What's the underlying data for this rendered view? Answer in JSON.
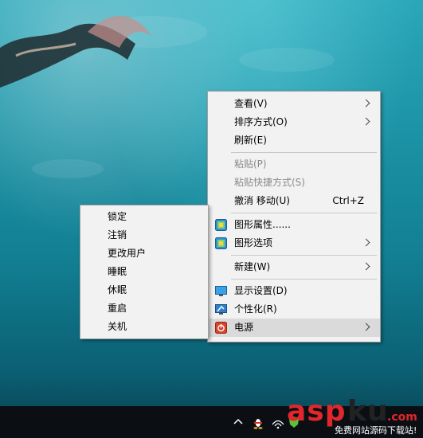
{
  "desktop_menu": {
    "items": [
      {
        "label": "查看(V)"
      },
      {
        "label": "排序方式(O)"
      },
      {
        "label": "刷新(E)"
      },
      {
        "label": "粘贴(P)"
      },
      {
        "label": "粘贴快捷方式(S)"
      },
      {
        "label": "撤消 移动(U)",
        "shortcut": "Ctrl+Z"
      },
      {
        "label": "图形属性......"
      },
      {
        "label": "图形选项"
      },
      {
        "label": "新建(W)"
      },
      {
        "label": "显示设置(D)"
      },
      {
        "label": "个性化(R)"
      },
      {
        "label": "电源"
      }
    ]
  },
  "power_submenu": {
    "items": [
      {
        "label": "锁定"
      },
      {
        "label": "注销"
      },
      {
        "label": "更改用户"
      },
      {
        "label": "睡眠"
      },
      {
        "label": "休眠"
      },
      {
        "label": "重启"
      },
      {
        "label": "关机"
      }
    ]
  },
  "watermark": {
    "brand_asp": "asp",
    "brand_ku": "ku",
    "brand_com": ".com",
    "tagline": "免费网站源码下载站!"
  },
  "colors": {
    "menu_bg": "#f2f2f2",
    "highlight": "#dadada",
    "disabled_text": "#8a8a8a",
    "taskbar": "#0b0f14",
    "brand_red": "#e3262b",
    "brand_dark": "#222222"
  },
  "icons": {
    "graphics_properties": "intel-graphics-icon",
    "graphics_options": "intel-graphics-icon",
    "display_settings": "monitor-icon",
    "personalize": "personalize-icon",
    "power": "power-icon",
    "tray_up": "chevron-up-icon",
    "tray_qq": "qq-penguin-icon",
    "tray_wifi": "wifi-icon",
    "tray_shield": "shield-icon"
  }
}
